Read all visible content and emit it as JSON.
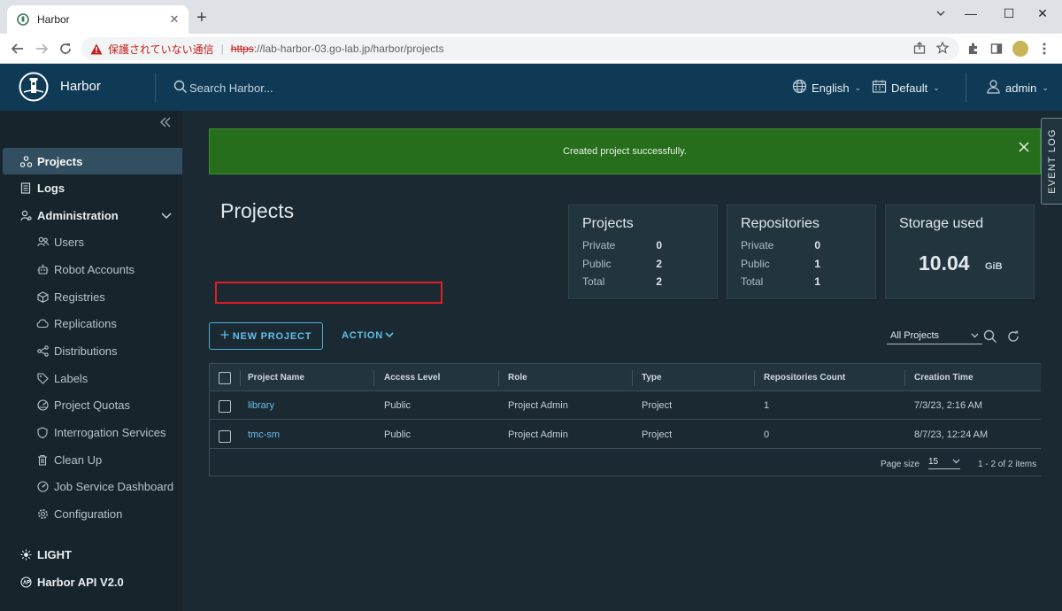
{
  "browser": {
    "tab_title": "Harbor",
    "insecure_label": "保護されていない通信",
    "url_scheme": "https",
    "url_rest": "://lab-harbor-03.go-lab.jp/harbor/projects",
    "minimize": "—",
    "maximize": "☐",
    "close": "✕"
  },
  "header": {
    "brand": "Harbor",
    "search_placeholder": "Search Harbor...",
    "language": "English",
    "theme_time": "Default",
    "user": "admin"
  },
  "sidebar": {
    "items": [
      {
        "label": "Projects",
        "icon": "projects-icon"
      },
      {
        "label": "Logs",
        "icon": "logs-icon"
      },
      {
        "label": "Administration",
        "icon": "administration-icon"
      },
      {
        "label": "Users",
        "icon": "users-icon"
      },
      {
        "label": "Robot Accounts",
        "icon": "robot-icon"
      },
      {
        "label": "Registries",
        "icon": "registries-icon"
      },
      {
        "label": "Replications",
        "icon": "replications-icon"
      },
      {
        "label": "Distributions",
        "icon": "distributions-icon"
      },
      {
        "label": "Labels",
        "icon": "labels-icon"
      },
      {
        "label": "Project Quotas",
        "icon": "quotas-icon"
      },
      {
        "label": "Interrogation Services",
        "icon": "shield-icon"
      },
      {
        "label": "Clean Up",
        "icon": "trash-icon"
      },
      {
        "label": "Job Service Dashboard",
        "icon": "dashboard-icon"
      },
      {
        "label": "Configuration",
        "icon": "gear-icon"
      }
    ],
    "light": "LIGHT",
    "api": "Harbor API V2.0"
  },
  "alert": {
    "message": "Created project successfully."
  },
  "page": {
    "title": "Projects"
  },
  "cards": {
    "projects": {
      "title": "Projects",
      "private_label": "Private",
      "private": "0",
      "public_label": "Public",
      "public": "2",
      "total_label": "Total",
      "total": "2"
    },
    "repositories": {
      "title": "Repositories",
      "private_label": "Private",
      "private": "0",
      "public_label": "Public",
      "public": "1",
      "total_label": "Total",
      "total": "1"
    },
    "storage": {
      "title": "Storage used",
      "value": "10.04",
      "unit": "GiB"
    }
  },
  "actions": {
    "new_project": "NEW PROJECT",
    "action": "ACTION",
    "filter": "All Projects"
  },
  "table": {
    "columns": [
      "Project Name",
      "Access Level",
      "Role",
      "Type",
      "Repositories Count",
      "Creation Time"
    ],
    "rows": [
      {
        "name": "library",
        "access": "Public",
        "role": "Project Admin",
        "type": "Project",
        "repos": "1",
        "created": "7/3/23, 2:16 AM"
      },
      {
        "name": "tmc-sm",
        "access": "Public",
        "role": "Project Admin",
        "type": "Project",
        "repos": "0",
        "created": "8/7/23, 12:24 AM"
      }
    ],
    "page_size_label": "Page size",
    "page_size": "15",
    "range": "1 - 2 of 2 items"
  },
  "event_log": "EVENT LOG"
}
